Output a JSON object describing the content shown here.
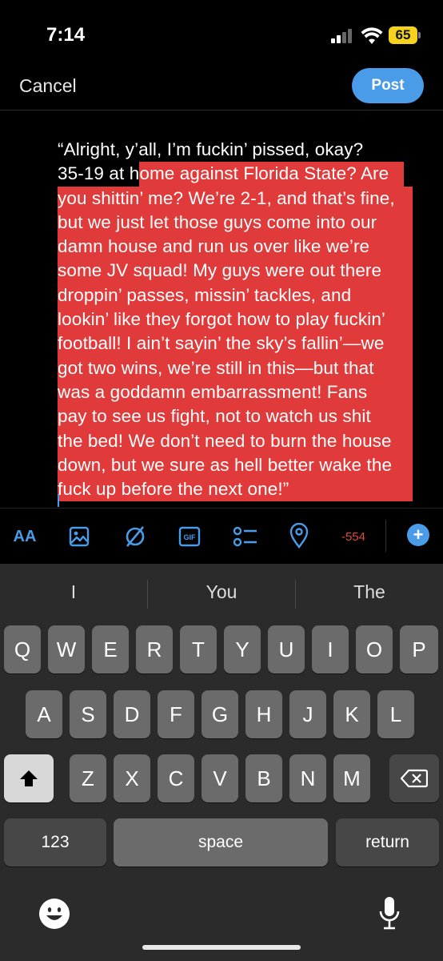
{
  "status": {
    "time": "7:14",
    "battery": "65"
  },
  "header": {
    "cancel": "Cancel",
    "post": "Post"
  },
  "composer": {
    "lines": [
      "“Alright, y’all, I’m fuckin’ pissed, okay?",
      "35-19 at h",
      "ome against Florida State? Are",
      "you shittin’ me? We’re 2-1, and that’s fine,",
      "but we just let those guys come into our",
      "damn house and run us over like we’re",
      "some JV squad! My guys were out there",
      "droppin’ passes, missin’ tackles, and",
      "lookin’ like they forgot how to play fuckin’",
      "football! I ain’t sayin’ the sky’s fallin’—we",
      "got two wins, we’re still in this—but that",
      "was a goddamn embarrassment! Fans",
      "pay to see us fight, not to watch us shit",
      "the bed! We don’t need to burn the house",
      "down, but we sure as hell better wake the",
      "fuck up before the next one!”"
    ]
  },
  "toolbar": {
    "font_label": "AA",
    "char_counter": "-554",
    "icons": [
      "text-size-icon",
      "image-icon",
      "no-sign-icon",
      "gif-icon",
      "poll-icon",
      "location-icon",
      "add-icon"
    ],
    "gif_label": "GIF"
  },
  "keyboard": {
    "suggestions": [
      "I",
      "You",
      "The"
    ],
    "row1": [
      "Q",
      "W",
      "E",
      "R",
      "T",
      "Y",
      "U",
      "I",
      "O",
      "P"
    ],
    "row2": [
      "A",
      "S",
      "D",
      "F",
      "G",
      "H",
      "J",
      "K",
      "L"
    ],
    "row3": [
      "Z",
      "X",
      "C",
      "V",
      "B",
      "N",
      "M"
    ],
    "numbers_key": "123",
    "space_key": "space",
    "return_key": "return"
  },
  "colors": {
    "accent": "#4a9ce8",
    "selection": "#e03a3a",
    "counter": "#e0493a"
  }
}
